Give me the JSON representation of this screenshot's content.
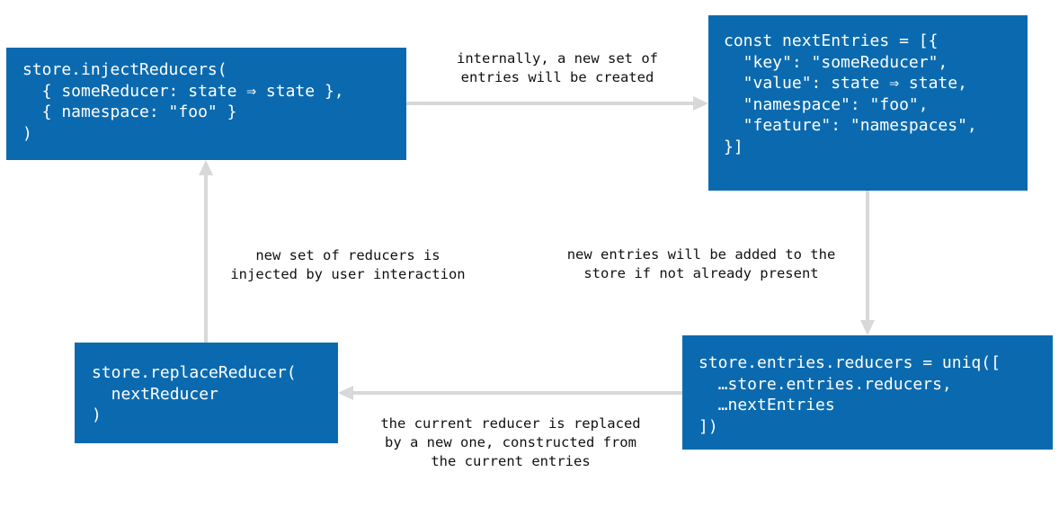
{
  "colors": {
    "box_fill": "#0b6aaf",
    "box_text": "#ffffff",
    "arrow": "#d8d8d8",
    "caption_text": "#111111"
  },
  "boxes": {
    "inject": {
      "lines": [
        "store.injectReducers(",
        "  { someReducer: state ⇒ state },",
        "  { namespace: \"foo\" }",
        ")"
      ]
    },
    "entries": {
      "lines": [
        "const nextEntries = [{",
        "  \"key\": \"someReducer\",",
        "  \"value\": state ⇒ state,",
        "  \"namespace\": \"foo\",",
        "  \"feature\": \"namespaces\",",
        "}]"
      ]
    },
    "store_entries": {
      "lines": [
        "store.entries.reducers = uniq([",
        "  …store.entries.reducers,",
        "  …nextEntries",
        "])"
      ]
    },
    "replace": {
      "lines": [
        "store.replaceReducer(",
        "  nextReducer",
        ")"
      ]
    }
  },
  "captions": {
    "top": [
      "internally, a new set of",
      "entries will be created"
    ],
    "right": [
      "new entries will be added to the",
      "store if not already present"
    ],
    "bottom": [
      "the current reducer is replaced",
      "by a new one, constructed from",
      "the current entries"
    ],
    "left": [
      "new set of reducers is",
      "injected by user interaction"
    ]
  }
}
